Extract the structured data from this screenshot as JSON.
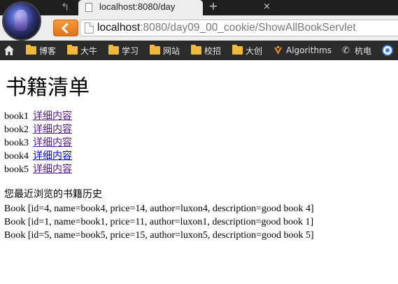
{
  "browser": {
    "tab": {
      "title": "localhost:8080/day",
      "close_glyph": "×"
    },
    "new_tab_glyph": "+",
    "back_tab_glyph": "↰",
    "address": {
      "host": "localhost",
      "rest": ":8080/day09_00_cookie/ShowAllBookServlet"
    },
    "bookmarks": [
      {
        "label": "博客",
        "icon": "folder-icon"
      },
      {
        "label": "大牛",
        "icon": "folder-icon"
      },
      {
        "label": "学习",
        "icon": "folder-icon"
      },
      {
        "label": "网站",
        "icon": "folder-icon"
      },
      {
        "label": "校招",
        "icon": "folder-icon"
      },
      {
        "label": "大创",
        "icon": "folder-icon"
      },
      {
        "label": "Algorithms",
        "icon": "algorithms-icon"
      },
      {
        "label": "杭电",
        "icon": "phone-icon"
      }
    ],
    "accent_color": "#e8801f"
  },
  "page": {
    "title": "书籍清单",
    "books": [
      {
        "name": "book1",
        "link_label": "详细内容",
        "visited": true
      },
      {
        "name": "book2",
        "link_label": "详细内容",
        "visited": true
      },
      {
        "name": "book3",
        "link_label": "详细内容",
        "visited": true
      },
      {
        "name": "book4",
        "link_label": "详细内容",
        "visited": false
      },
      {
        "name": "book5",
        "link_label": "详细内容",
        "visited": true
      }
    ],
    "history_heading": "您最近浏览的书籍历史",
    "history": [
      "Book [id=4, name=book4, price=14, author=luxon4, description=good book 4]",
      "Book [id=1, name=book1, price=11, author=luxon1, description=good book 1]",
      "Book [id=5, name=book5, price=15, author=luxon5, description=good book 5]"
    ]
  }
}
